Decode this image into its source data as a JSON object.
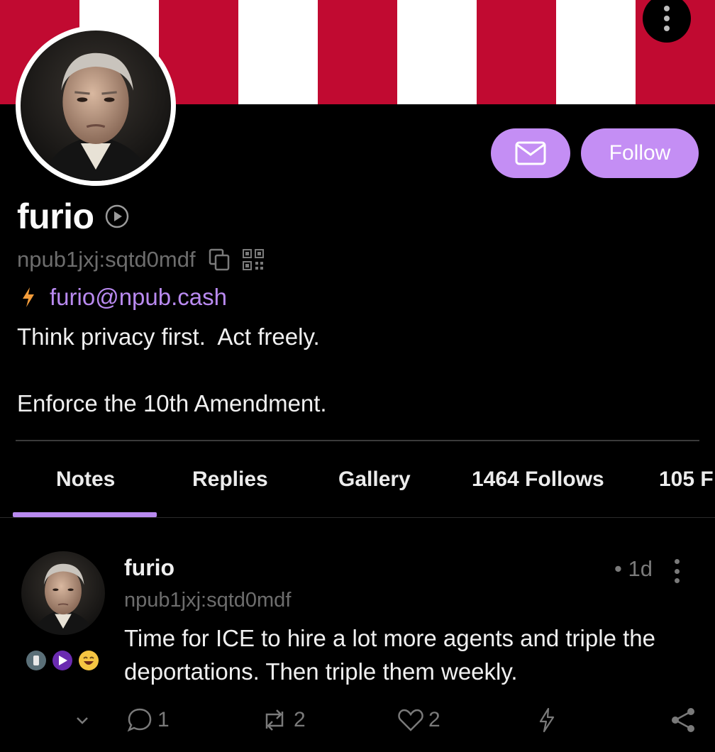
{
  "colors": {
    "accent": "#c48ef4",
    "banner_red": "#c10a31",
    "banner_white": "#ffffff",
    "lightning": "#f39c3a",
    "muted": "#6d6d6d"
  },
  "banner": {
    "stripes": [
      "red",
      "white",
      "red",
      "white",
      "red",
      "white",
      "red",
      "white",
      "red"
    ]
  },
  "header": {
    "menu_icon": "vertical-dots-icon"
  },
  "profile": {
    "name": "furio",
    "npub": "npub1jxj:sqtd0mdf",
    "lightning_address": "furio@npub.cash",
    "bio_line1": "Think privacy first.  Act freely.",
    "bio_line2": "Enforce the 10th Amendment.",
    "follow_label": "Follow"
  },
  "tabs": [
    {
      "label": "Notes",
      "active": true
    },
    {
      "label": "Replies",
      "active": false
    },
    {
      "label": "Gallery",
      "active": false
    },
    {
      "label": "1464 Follows",
      "active": false
    },
    {
      "label": "105 F",
      "active": false
    }
  ],
  "note": {
    "author": "furio",
    "npub": "npub1jxj:sqtd0mdf",
    "time": "• 1d",
    "text": "Time for ICE to hire a lot more agents and triple the deportations.  Then triple them weekly.",
    "replies": "1",
    "reposts": "2",
    "likes": "2"
  }
}
